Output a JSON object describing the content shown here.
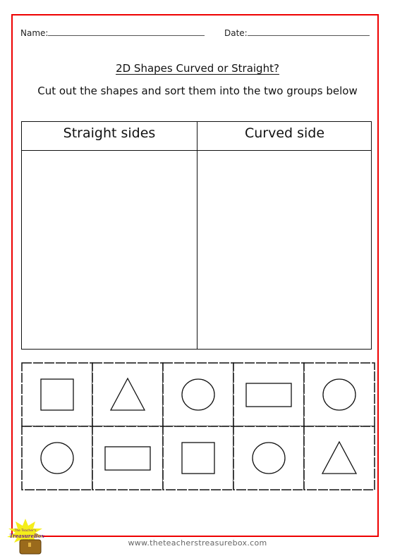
{
  "worksheet": {
    "fields": {
      "name_label": "Name:",
      "date_label": "Date:"
    },
    "title": "2D Shapes Curved or Straight?",
    "instructions": "Cut out the shapes and sort them into the two groups below",
    "sort_table": {
      "columns": [
        {
          "heading": "Straight sides"
        },
        {
          "heading": "Curved side"
        }
      ]
    },
    "cutout_shapes": {
      "rows": [
        [
          "square",
          "triangle",
          "circle",
          "rectangle",
          "circle"
        ],
        [
          "circle",
          "rectangle",
          "square",
          "circle",
          "triangle"
        ]
      ]
    },
    "footer": {
      "website": "www.theteacherstreasurebox.com",
      "logo_line1": "The Teacher's",
      "logo_line2": "TreasureBox"
    },
    "colors": {
      "border": "#ee0000",
      "logo_star": "#f5ee1a",
      "logo_text": "#6a1f8a",
      "logo_chest": "#9a6a1c"
    }
  }
}
